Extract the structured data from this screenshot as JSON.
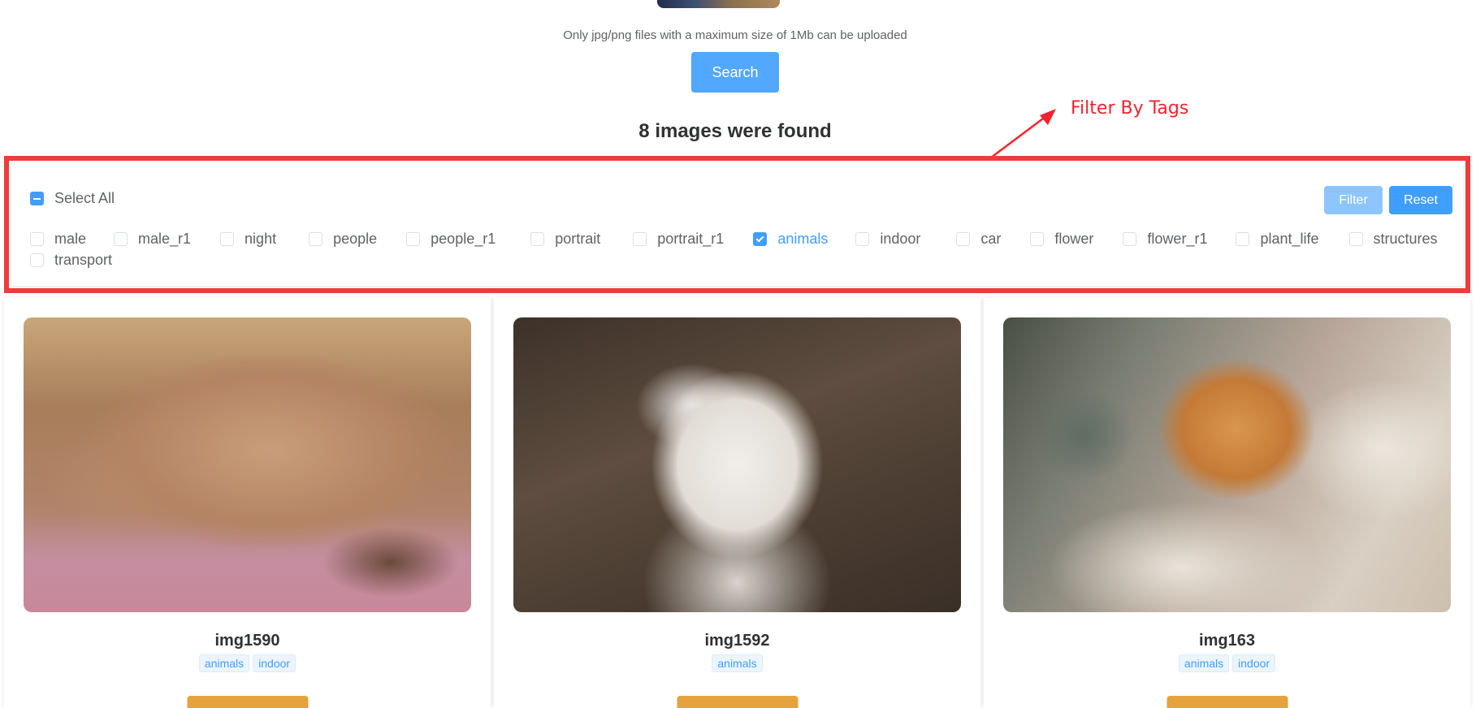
{
  "upload": {
    "hint": "Only jpg/png files with a maximum size of 1Mb can be uploaded",
    "search_label": "Search"
  },
  "results": {
    "found_text": "8 images were found"
  },
  "annotation": {
    "text": "Filter By Tags",
    "color": "#f5222d"
  },
  "filter": {
    "select_all_label": "Select All",
    "select_all_state": "indeterminate",
    "filter_label": "Filter",
    "reset_label": "Reset",
    "tags": [
      {
        "label": "male",
        "checked": false
      },
      {
        "label": "male_r1",
        "checked": false
      },
      {
        "label": "night",
        "checked": false
      },
      {
        "label": "people",
        "checked": false
      },
      {
        "label": "people_r1",
        "checked": false
      },
      {
        "label": "portrait",
        "checked": false
      },
      {
        "label": "portrait_r1",
        "checked": false
      },
      {
        "label": "animals",
        "checked": true
      },
      {
        "label": "indoor",
        "checked": false
      },
      {
        "label": "car",
        "checked": false
      },
      {
        "label": "flower",
        "checked": false
      },
      {
        "label": "flower_r1",
        "checked": false
      },
      {
        "label": "plant_life",
        "checked": false
      },
      {
        "label": "structures",
        "checked": false
      },
      {
        "label": "transport",
        "checked": false
      }
    ]
  },
  "cards": [
    {
      "title": "img1590",
      "tags": [
        "animals",
        "indoor"
      ],
      "image": "rabbit-photo"
    },
    {
      "title": "img1592",
      "tags": [
        "animals"
      ],
      "image": "white-cat-photo"
    },
    {
      "title": "img163",
      "tags": [
        "animals",
        "indoor"
      ],
      "image": "orange-cat-photo"
    }
  ],
  "colors": {
    "primary": "#409eff",
    "highlight_border": "#ef3b3b",
    "card_button": "#e6a23c"
  }
}
